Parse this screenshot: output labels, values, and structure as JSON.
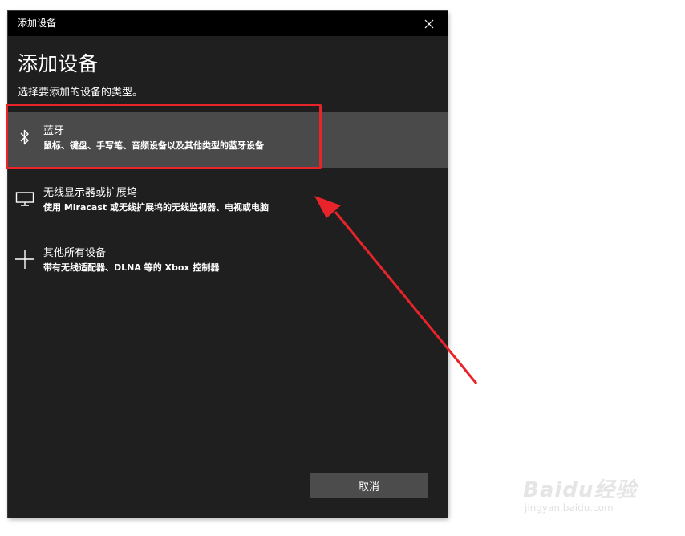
{
  "window": {
    "title": "添加设备",
    "heading": "添加设备",
    "subheading": "选择要添加的设备的类型。"
  },
  "options": [
    {
      "icon": "bluetooth-icon",
      "label": "蓝牙",
      "description": "鼠标、键盘、手写笔、音频设备以及其他类型的蓝牙设备",
      "selected": true
    },
    {
      "icon": "monitor-icon",
      "label": "无线显示器或扩展坞",
      "description": "使用 Miracast 或无线扩展坞的无线监视器、电视或电脑",
      "selected": false
    },
    {
      "icon": "plus-icon",
      "label": "其他所有设备",
      "description": "带有无线适配器、DLNA 等的 Xbox 控制器",
      "selected": false
    }
  ],
  "buttons": {
    "cancel": "取消"
  },
  "annotation": {
    "color": "#e8242a"
  },
  "watermark": {
    "main": "Baidu经验",
    "sub": "jingyan.baidu.com"
  }
}
